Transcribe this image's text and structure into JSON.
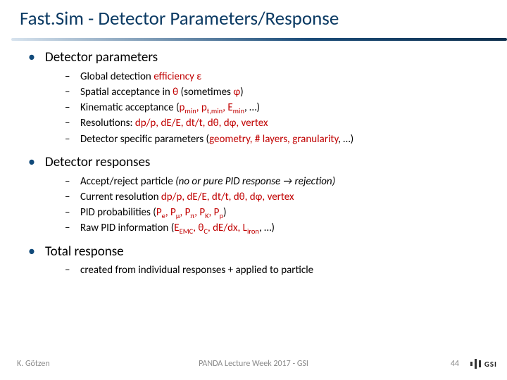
{
  "title": "Fast.Sim - Detector Parameters/Response",
  "sections": {
    "params": {
      "heading": "Detector parameters",
      "items": [
        {
          "prefix": "Global detection ",
          "accent": "efficiency ε",
          "suffix": ""
        },
        {
          "prefix": "Spatial acceptance in ",
          "accent": "θ",
          "mid": " (sometimes ",
          "accent2": "φ",
          "suffix": ")"
        },
        {
          "prefix": "Kinematic acceptance (",
          "accent_html": "p<sub>min</sub>, p<sub>t,min</sub>, E<sub>min</sub>",
          "suffix": ", …)"
        },
        {
          "prefix": "Resolutions: ",
          "accent": "dp/p, dE/E, dt/t, dθ, dφ, vertex",
          "suffix": ""
        },
        {
          "prefix": "Detector specific parameters (",
          "accent": "geometry, # layers, granularity",
          "suffix": ", …)"
        }
      ]
    },
    "responses": {
      "heading": "Detector responses",
      "items": [
        {
          "prefix": "Accept/reject particle ",
          "italic": "(no or pure PID response  → rejection)"
        },
        {
          "prefix": "Current resolution ",
          "accent": "dp/p, dE/E, dt/t, dθ, dφ, vertex",
          "suffix": ""
        },
        {
          "prefix": "PID probabilities (",
          "accent_html": "P<sub>e</sub>, P<sub>μ</sub>, P<sub>π</sub>, P<sub>K</sub>, P<sub>p</sub>",
          "suffix": ")"
        },
        {
          "prefix": "Raw PID information (",
          "accent_html": "E<sub>EMC</sub>, θ<sub>C</sub>, dE/dx, L<sub>iron</sub>",
          "suffix": ", …)"
        }
      ]
    },
    "total": {
      "heading": "Total response",
      "items": [
        {
          "text": "created from individual responses + applied to particle"
        }
      ]
    }
  },
  "footer": {
    "author": "K. Götzen",
    "venue": "PANDA Lecture Week 2017 - GSI",
    "page": "44",
    "logo_text": "GSI"
  }
}
